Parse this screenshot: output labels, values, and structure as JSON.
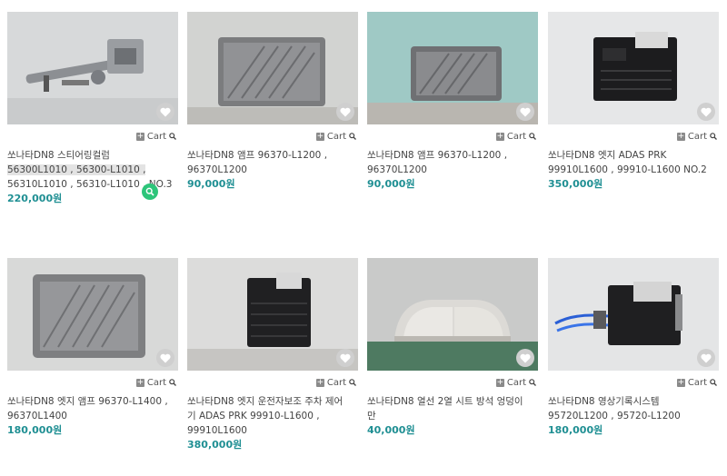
{
  "cart_label": "Cart",
  "products": [
    {
      "title_lines": [
        "쏘나타DN8 스티어링컬럼",
        "56300L1010 , 56300-L1010 ,",
        "56310L1010 , 56310-L1010 , NO.3"
      ],
      "price": "220,000원",
      "image": "steering-column"
    },
    {
      "title_lines": [
        "쏘나타DN8 앰프 96370-L1200 ,",
        "96370L1200"
      ],
      "price": "90,000원",
      "image": "amplifier"
    },
    {
      "title_lines": [
        "쏘나타DN8 앰프 96370-L1200 ,",
        "96370L1200"
      ],
      "price": "90,000원",
      "image": "amplifier"
    },
    {
      "title_lines": [
        "쏘나타DN8 엣지 ADAS PRK",
        "99910L1600 , 99910-L1600 NO.2"
      ],
      "price": "350,000원",
      "image": "adas-module"
    },
    {
      "title_lines": [
        "쏘나타DN8 엣지 앰프 96370-L1400 ,",
        "96370L1400"
      ],
      "price": "180,000원",
      "image": "amplifier"
    },
    {
      "title_lines": [
        "쏘나타DN8 엣지 운전자보조 주차 제어",
        "기 ADAS PRK 99910-L1600 ,",
        "99910L1600"
      ],
      "price": "380,000원",
      "image": "adas-module"
    },
    {
      "title_lines": [
        "쏘나타DN8 열선 2열 시트 방석 엉덩이",
        "만"
      ],
      "price": "40,000원",
      "image": "seat-cushion"
    },
    {
      "title_lines": [
        "쏘나타DN8 영상기록시스템",
        "95720L1200 , 95720-L1200"
      ],
      "price": "180,000원",
      "image": "video-recorder"
    }
  ]
}
